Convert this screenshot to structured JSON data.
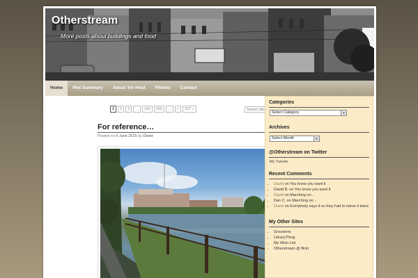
{
  "header": {
    "site_title": "Otherstream",
    "site_description": "More posts about buildings and food"
  },
  "nav": {
    "items": [
      "Home",
      "Plot Summary",
      "About Yer Host",
      "Photos",
      "Contact"
    ]
  },
  "pagination": {
    "pages": [
      "1",
      "2",
      "3",
      "...",
      "100",
      "200",
      "...",
      "»",
      "327 »"
    ]
  },
  "search": {
    "placeholder": "Search Site"
  },
  "post": {
    "title": "For reference…",
    "posted_on_label": "Posted on",
    "date": "6 June 2015",
    "by_label": "by",
    "author": "David"
  },
  "sidebar": {
    "categories": {
      "title": "Categories",
      "selected": "Select Category"
    },
    "archives": {
      "title": "Archives",
      "selected": "Select Month"
    },
    "twitter": {
      "title": "@Otherstream on Twitter",
      "link": "My Tweets"
    },
    "recent_comments": {
      "title": "Recent Comments",
      "items": [
        {
          "author": "David",
          "on": "on",
          "post": "You know you want it"
        },
        {
          "author": "David B.",
          "on": "on",
          "post": "You know you want it"
        },
        {
          "author": "David",
          "on": "on",
          "post": "Marching on…"
        },
        {
          "author": "Dan C.",
          "on": "on",
          "post": "Marching on…"
        },
        {
          "author": "David",
          "on": "on",
          "post": "Everybody says it so they had to name it twice"
        }
      ]
    },
    "other_sites": {
      "title": "My Other Sites",
      "items": [
        "Grocetera",
        "LibraryThing",
        "My Wish List",
        "Otherstream @ flickr"
      ]
    }
  },
  "colors": {
    "sidebar_bg": "#fbebc7",
    "nav_bg": "#b3a78f",
    "comment_author": "#8a7a52"
  }
}
